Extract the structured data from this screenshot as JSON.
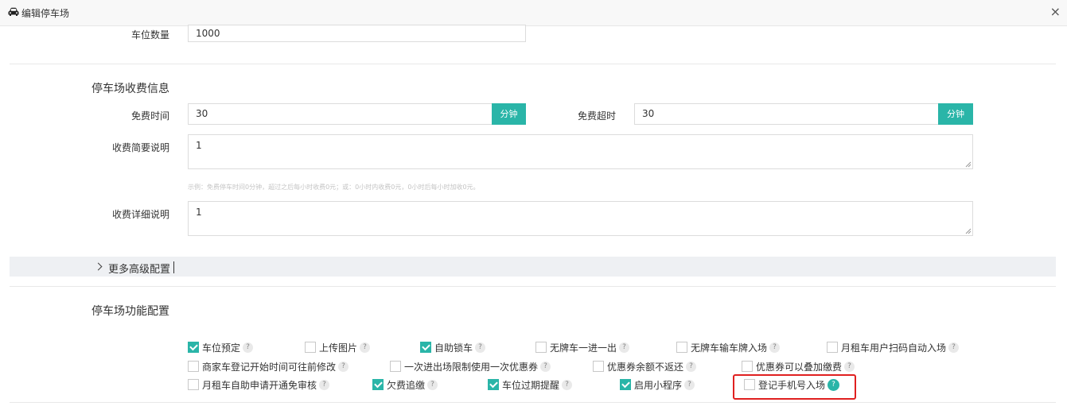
{
  "dialog": {
    "title": "编辑停车场",
    "close_glyph": "×"
  },
  "fields": {
    "space_count": {
      "label": "车位数量",
      "value": "1000"
    }
  },
  "fee": {
    "section_title": "停车场收费信息",
    "free_time": {
      "label": "免费时间",
      "value": "30",
      "unit": "分钟"
    },
    "free_overtime": {
      "label": "免费超时",
      "value": "30",
      "unit": "分钟"
    },
    "brief": {
      "label": "收费简要说明",
      "value": "1"
    },
    "hint": "示例：免费停车时间0分钟，超过之后每小时收费0元；或：0小时内收费0元，0小时后每小时加收0元。",
    "detail": {
      "label": "收费详细说明",
      "value": "1"
    }
  },
  "advanced": {
    "label": "更多高级配置"
  },
  "features": {
    "section_title": "停车场功能配置",
    "help_glyph": "?",
    "options": [
      {
        "label": "车位预定",
        "checked": true
      },
      {
        "label": "上传图片",
        "checked": false
      },
      {
        "label": "自助锁车",
        "checked": true
      },
      {
        "label": "无牌车一进一出",
        "checked": false
      },
      {
        "label": "无牌车输车牌入场",
        "checked": false
      },
      {
        "label": "月租车用户扫码自动入场",
        "checked": false
      },
      {
        "label": "商家车登记开始时间可往前修改",
        "checked": false
      },
      {
        "label": "一次进出场限制使用一次优惠券",
        "checked": false
      },
      {
        "label": "优惠券余额不返还",
        "checked": false
      },
      {
        "label": "优惠券可以叠加缴费",
        "checked": false
      },
      {
        "label": "月租车自助申请开通免审核",
        "checked": false
      },
      {
        "label": "欠费追缴",
        "checked": true
      },
      {
        "label": "车位过期提醒",
        "checked": true
      },
      {
        "label": "启用小程序",
        "checked": true
      },
      {
        "label": "登记手机号入场",
        "checked": false
      }
    ]
  },
  "colors": {
    "accent": "#2ab5a8",
    "highlight": "#e02020"
  }
}
